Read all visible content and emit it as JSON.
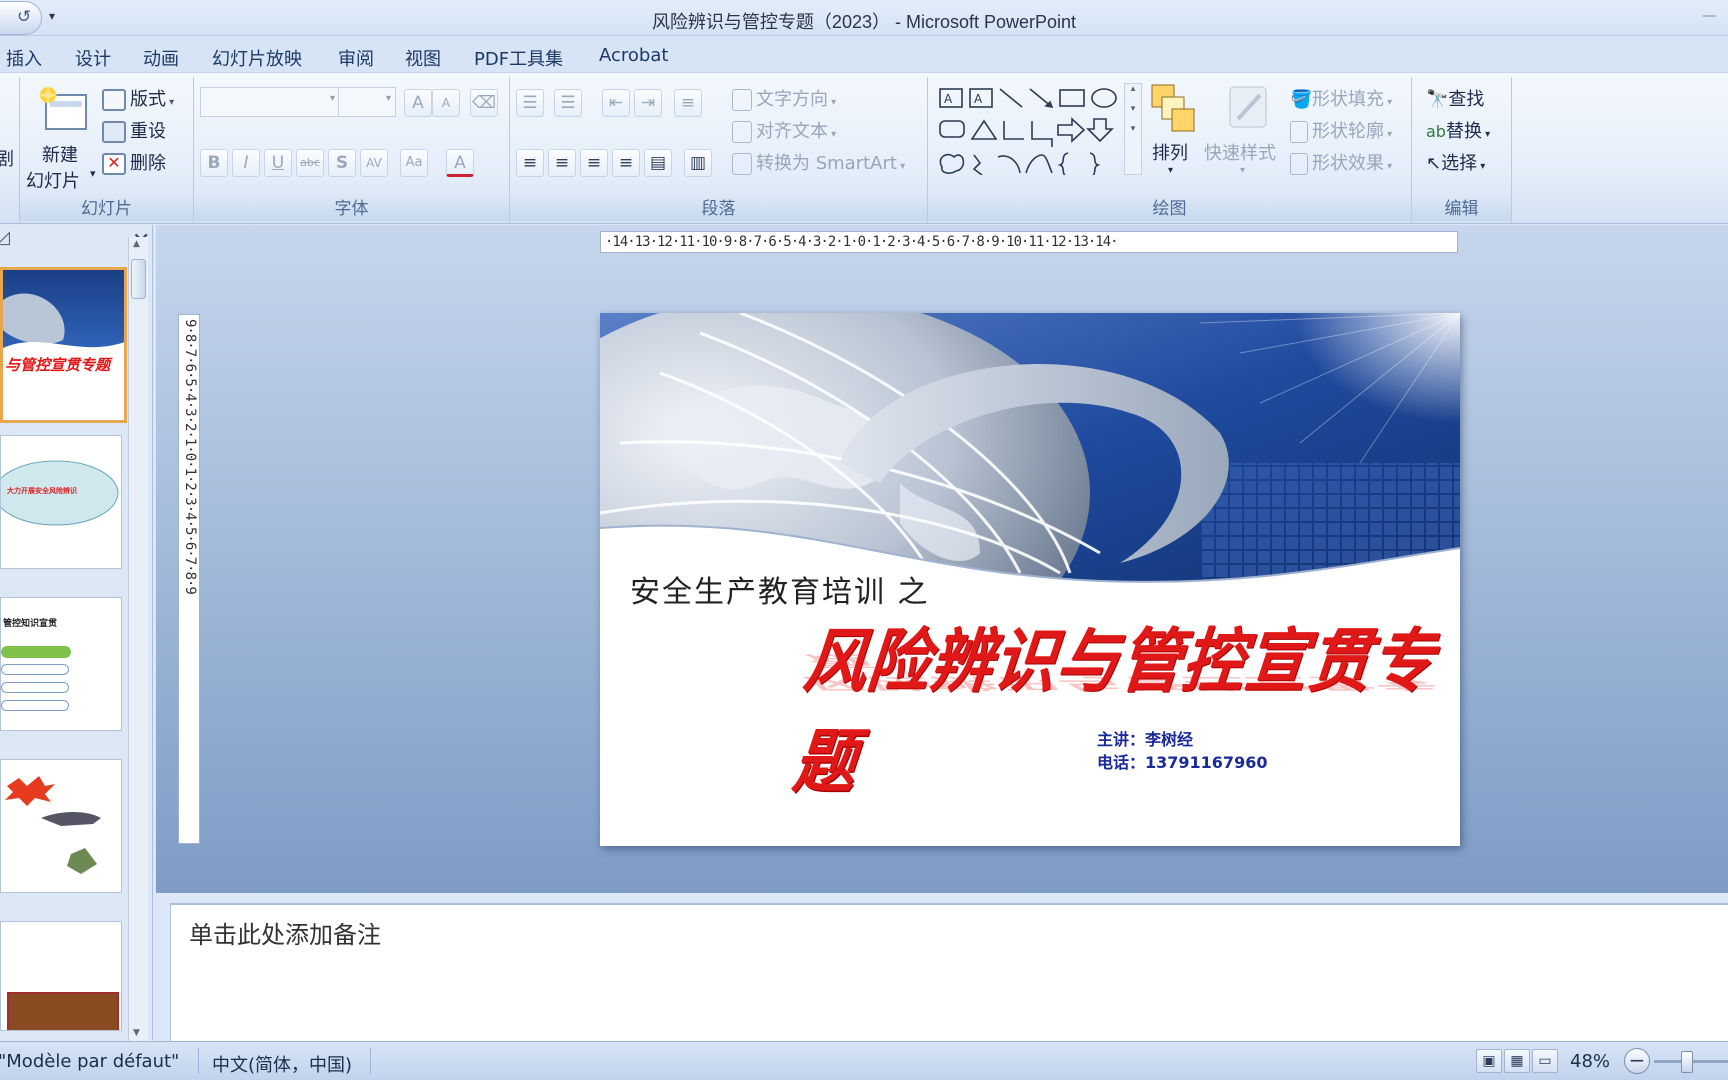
{
  "window": {
    "title": "风险辨识与管控专题（2023） - Microsoft PowerPoint"
  },
  "tabs": [
    "插入",
    "设计",
    "动画",
    "幻灯片放映",
    "审阅",
    "视图",
    "PDF工具集",
    "Acrobat"
  ],
  "ribbon": {
    "slides_group": {
      "label": "幻灯片",
      "new_slide_line1": "新建",
      "new_slide_line2": "幻灯片",
      "layout": "版式",
      "reset": "重设",
      "delete": "删除",
      "clipboard_fragment": "剧"
    },
    "font_group": {
      "label": "字体",
      "bold": "B",
      "italic": "I",
      "underline": "U",
      "strike": "abc",
      "shadow": "S",
      "spacing": "AV",
      "case": "Aa",
      "color": "A",
      "grow": "A",
      "shrink": "A"
    },
    "paragraph_group": {
      "label": "段落",
      "text_direction": "文字方向",
      "align_text": "对齐文本",
      "smartart": "转换为 SmartArt"
    },
    "drawing_group": {
      "label": "绘图",
      "arrange": "排列",
      "quick_styles": "快速样式",
      "shape_fill": "形状填充",
      "shape_outline": "形状轮廓",
      "shape_effects": "形状效果"
    },
    "editing_group": {
      "label": "编辑",
      "find": "查找",
      "replace": "替换",
      "select": "选择"
    }
  },
  "rulers": {
    "horizontal": "·14·13·12·11·10·9·8·7·6·5·4·3·2·1·0·1·2·3·4·5·6·7·8·9·10·11·12·13·14·",
    "vertical": "9·8·7·6·5·4·3·2·1·0·1·2·3·4·5·6·7·8·9"
  },
  "thumbnails": [
    {
      "text": "与管控宣贯专题"
    },
    {
      "text": "大力开展安全风险辨识"
    },
    {
      "text": "管控知识宣贯"
    },
    {
      "text": ""
    },
    {
      "text": ""
    }
  ],
  "slide": {
    "subtitle": "安全生产教育培训 之",
    "title": "风险辨识与管控宣贯专题",
    "presenter": "主讲：李树经",
    "phone": "电话：13791167960"
  },
  "notes": {
    "placeholder": "单击此处添加备注"
  },
  "status": {
    "theme": "\"Modèle par défaut\"",
    "language": "中文(简体，中国)",
    "zoom": "48%"
  },
  "colors": {
    "title_red": "#e01818",
    "presenter_blue": "#1a2a9a",
    "ribbon_bg": "#e3edf9"
  }
}
